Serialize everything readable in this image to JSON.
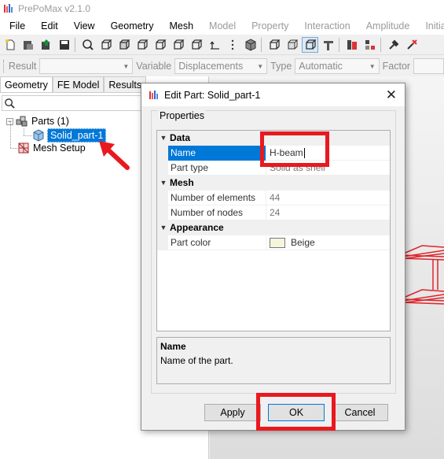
{
  "app": {
    "title": "PrePoMax v2.1.0"
  },
  "menu": [
    "File",
    "Edit",
    "View",
    "Geometry",
    "Mesh",
    "Model",
    "Property",
    "Interaction",
    "Amplitude",
    "Initial Co"
  ],
  "results_bar": {
    "result_label": "Result",
    "result_value": "",
    "variable_label": "Variable",
    "variable_value": "Displacements",
    "type_label": "Type",
    "type_value": "Automatic",
    "factor_label": "Factor"
  },
  "left_panel": {
    "tabs": [
      "Geometry",
      "FE Model",
      "Results"
    ],
    "tree": {
      "parts_label": "Parts (1)",
      "part_item": "Solid_part-1",
      "mesh_setup": "Mesh Setup"
    }
  },
  "dialog": {
    "title": "Edit Part: Solid_part-1",
    "group_label": "Properties",
    "categories": {
      "data": "Data",
      "mesh": "Mesh",
      "appearance": "Appearance"
    },
    "rows": {
      "name_label": "Name",
      "name_value": "H-beam",
      "part_type_label": "Part type",
      "part_type_value": "Solid as shell",
      "num_elements_label": "Number of elements",
      "num_elements_value": "44",
      "num_nodes_label": "Number of nodes",
      "num_nodes_value": "24",
      "part_color_label": "Part color",
      "part_color_value": "Beige",
      "part_color_hex": "#f5f5dc"
    },
    "help": {
      "title": "Name",
      "description": "Name of the part."
    },
    "buttons": {
      "apply": "Apply",
      "ok": "OK",
      "cancel": "Cancel"
    }
  },
  "colors": {
    "selection": "#0078d7",
    "annotation_red": "#e8191f",
    "mesh_red": "#e0242a"
  }
}
